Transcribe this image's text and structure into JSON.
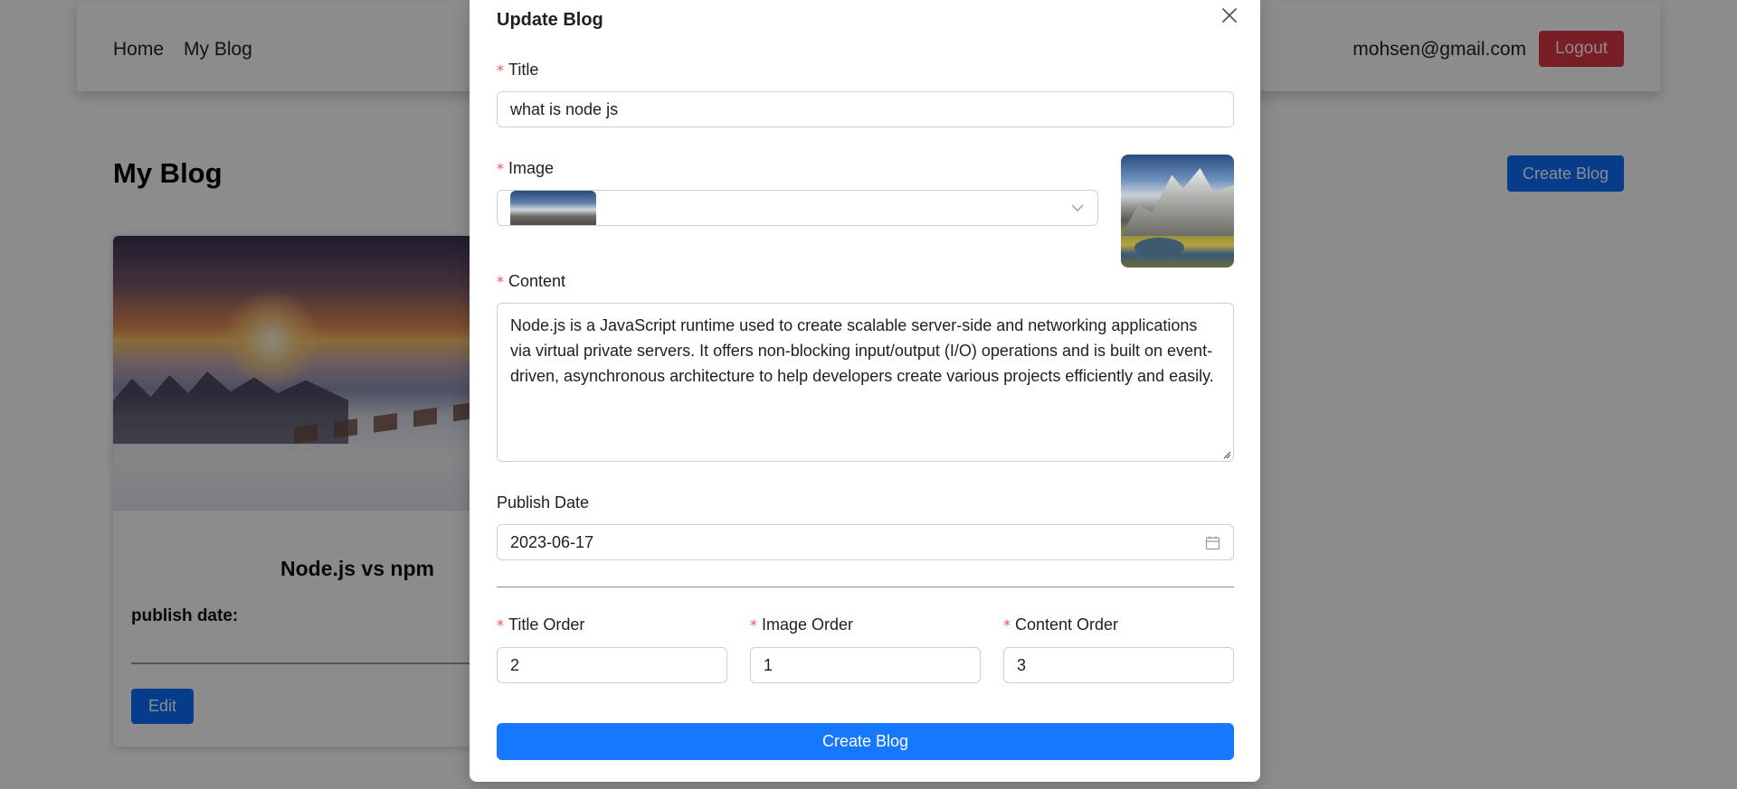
{
  "navbar": {
    "links": [
      {
        "label": "Home"
      },
      {
        "label": "My Blog"
      }
    ],
    "user_email": "mohsen@gmail.com",
    "logout_label": "Logout"
  },
  "page": {
    "title": "My Blog",
    "create_button_label": "Create Blog"
  },
  "card": {
    "title": "Node.js vs npm",
    "publish_label": "publish date:",
    "edit_label": "Edit"
  },
  "modal": {
    "title": "Update Blog",
    "fields": {
      "title": {
        "label": "Title",
        "value": "what is node js"
      },
      "image": {
        "label": "Image"
      },
      "content": {
        "label": "Content",
        "value": "Node.js is a JavaScript runtime used to create scalable server-side and networking applications via virtual private servers. It offers non-blocking input/output (I/O) operations and is built on event-driven, asynchronous architecture to help developers create various projects efficiently and easily."
      },
      "publish_date": {
        "label": "Publish Date",
        "value": "2023-06-17"
      },
      "title_order": {
        "label": "Title Order",
        "value": "2"
      },
      "image_order": {
        "label": "Image Order",
        "value": "1"
      },
      "content_order": {
        "label": "Content Order",
        "value": "3"
      }
    },
    "required_mark": "*",
    "submit_label": "Create Blog"
  },
  "colors": {
    "primary": "#1677ff",
    "bootstrap_primary": "#0d6efd",
    "danger": "#dc3545",
    "required": "#ff4d4f"
  }
}
